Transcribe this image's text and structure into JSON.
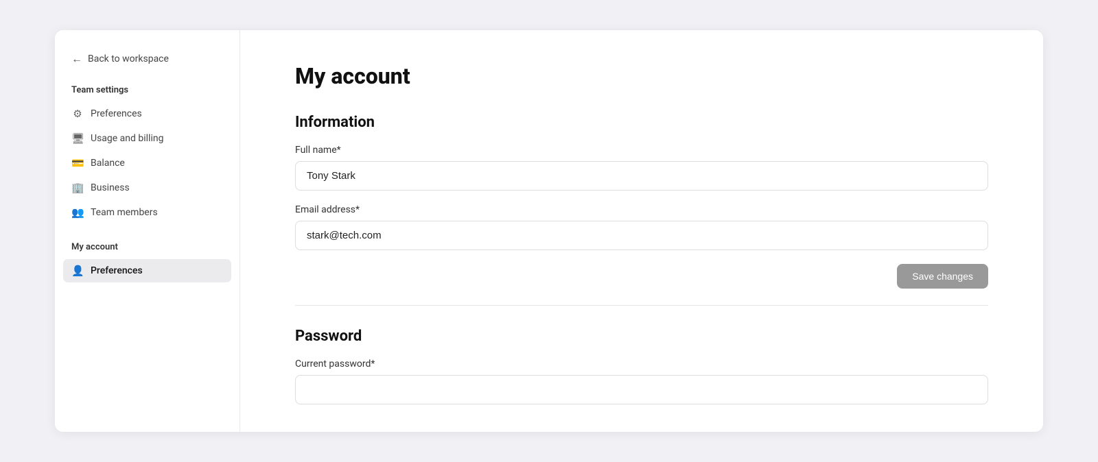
{
  "sidebar": {
    "back_label": "Back to workspace",
    "team_settings_label": "Team settings",
    "team_nav": [
      {
        "id": "preferences",
        "label": "Preferences",
        "icon": "⚙"
      },
      {
        "id": "usage-and-billing",
        "label": "Usage and billing",
        "icon": "🖥"
      },
      {
        "id": "balance",
        "label": "Balance",
        "icon": "💳"
      },
      {
        "id": "business",
        "label": "Business",
        "icon": "🏢"
      },
      {
        "id": "team-members",
        "label": "Team members",
        "icon": "👥"
      }
    ],
    "my_account_label": "My account",
    "account_nav": [
      {
        "id": "account-preferences",
        "label": "Preferences",
        "icon": "👤",
        "active": true
      }
    ]
  },
  "main": {
    "page_title": "My account",
    "info_section": {
      "title": "Information",
      "full_name_label": "Full name*",
      "full_name_value": "Tony Stark",
      "email_label": "Email address*",
      "email_value": "stark@tech.com",
      "save_label": "Save changes"
    },
    "password_section": {
      "title": "Password",
      "current_password_label": "Current password*",
      "current_password_placeholder": ""
    }
  }
}
